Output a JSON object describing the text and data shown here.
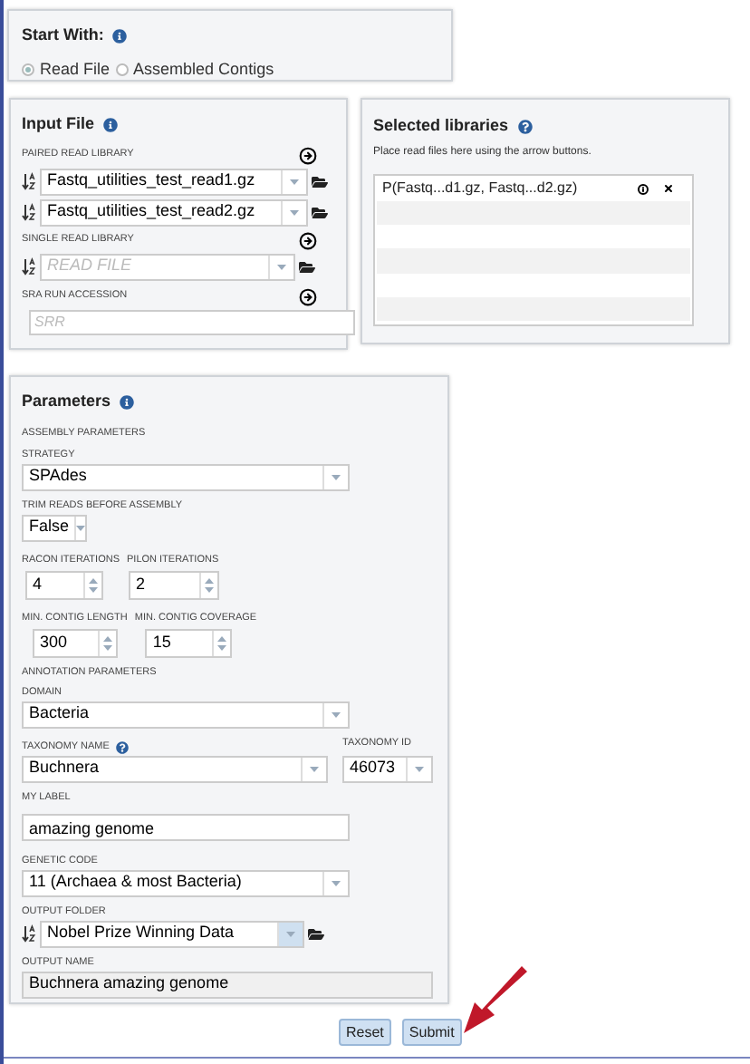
{
  "start_with": {
    "title": "Start With:",
    "options": [
      {
        "label": "Read File",
        "selected": true
      },
      {
        "label": "Assembled Contigs",
        "selected": false
      }
    ]
  },
  "input_file": {
    "title": "Input File",
    "paired_label": "PAIRED READ LIBRARY",
    "paired_files": [
      "Fastq_utilities_test_read1.gz",
      "Fastq_utilities_test_read2.gz"
    ],
    "single_label": "SINGLE READ LIBRARY",
    "single_placeholder": "READ FILE",
    "sra_label": "SRA RUN ACCESSION",
    "sra_placeholder": "SRR"
  },
  "selected_libraries": {
    "title": "Selected libraries",
    "hint": "Place read files here using the arrow buttons.",
    "items": [
      "P(Fastq...d1.gz, Fastq...d2.gz)"
    ]
  },
  "parameters": {
    "title": "Parameters",
    "assembly_heading": "ASSEMBLY PARAMETERS",
    "strategy": {
      "label": "STRATEGY",
      "value": "SPAdes"
    },
    "trim": {
      "label": "TRIM READS BEFORE ASSEMBLY",
      "value": "False"
    },
    "racon": {
      "label": "RACON ITERATIONS",
      "value": "4"
    },
    "pilon": {
      "label": "PILON ITERATIONS",
      "value": "2"
    },
    "min_length": {
      "label": "MIN. CONTIG LENGTH",
      "value": "300"
    },
    "min_coverage": {
      "label": "MIN. CONTIG COVERAGE",
      "value": "15"
    },
    "annotation_heading": "ANNOTATION PARAMETERS",
    "domain": {
      "label": "DOMAIN",
      "value": "Bacteria"
    },
    "taxonomy_name": {
      "label": "TAXONOMY NAME",
      "value": "Buchnera"
    },
    "taxonomy_id": {
      "label": "TAXONOMY ID",
      "value": "46073"
    },
    "my_label": {
      "label": "MY LABEL",
      "value": "amazing genome"
    },
    "genetic_code": {
      "label": "GENETIC CODE",
      "value": "11 (Archaea & most Bacteria)"
    },
    "output_folder": {
      "label": "OUTPUT FOLDER",
      "value": "Nobel Prize Winning Data"
    },
    "output_name": {
      "label": "OUTPUT NAME",
      "value": "Buchnera amazing genome"
    }
  },
  "buttons": [
    "Reset",
    "Submit"
  ]
}
